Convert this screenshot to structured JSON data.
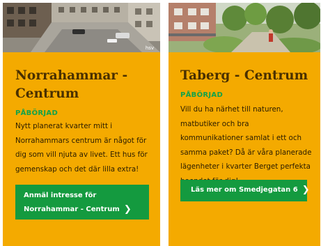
{
  "cards": [
    {
      "image_alt": "apartment courtyard photo",
      "watermark": "hsv",
      "title": "Norrahammar - Centrum",
      "status": "PÅBÖRJAD",
      "description": "Nytt planerat kvarter mitt i Norrahammars centrum är något för dig som vill njuta av livet. Ett hus för gemenskap och det där lilla extra!",
      "button_line1": "Anmäl intresse för",
      "button_line2": "Norrahammar - Centrum",
      "button_icon": "chevron-right-icon"
    },
    {
      "image_alt": "apartment building with trees photo",
      "title": "Taberg - Centrum",
      "status": "PÅBÖRJAD",
      "description": "Vill du ha närhet till naturen, matbutiker och bra kommunikationer samlat i ett och samma paket? Då är våra planerade lägenheter i kvarter Berget perfekta boendet för dig!",
      "button_label": "Läs mer om Smedjegatan 6",
      "button_icon": "chevron-right-icon"
    }
  ],
  "colors": {
    "card_background": "#f4aa00",
    "title": "#4a3000",
    "status": "#12a24a",
    "button": "#149a3f",
    "button_text": "#ffffff"
  }
}
